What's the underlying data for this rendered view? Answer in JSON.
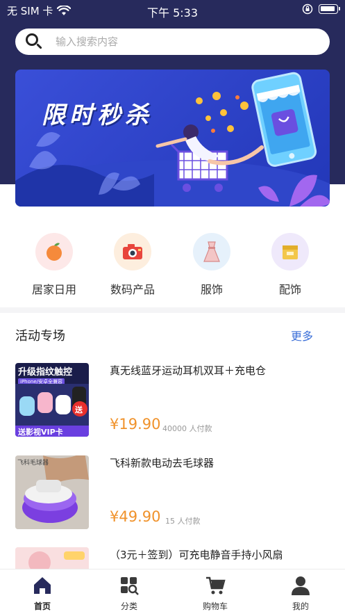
{
  "status_bar": {
    "carrier": "无 SIM 卡",
    "time": "下午 5:33"
  },
  "search": {
    "placeholder": "输入搜索内容"
  },
  "banner": {
    "title": "限时秒杀"
  },
  "categories": [
    {
      "label": "居家日用",
      "icon": "orange-icon"
    },
    {
      "label": "数码产品",
      "icon": "camera-icon"
    },
    {
      "label": "服饰",
      "icon": "dress-icon"
    },
    {
      "label": "配饰",
      "icon": "box-icon"
    }
  ],
  "section": {
    "title": "活动专场",
    "more": "更多"
  },
  "products": [
    {
      "title": "真无线蓝牙运动耳机双耳＋充电仓",
      "price": "¥19.90",
      "sold": "40000 人付款",
      "thumb_text_top": "升级指纹触控",
      "thumb_text_sub": "iPhone/安卓全兼容",
      "thumb_text_bottom": "送影视VIP卡",
      "thumb_text_badge": "送"
    },
    {
      "title": "飞科新款电动去毛球器",
      "price": "¥49.90",
      "sold": "15 人付款",
      "thumb_text_top": "飞科毛球器"
    },
    {
      "title": "（3元＋签到）可充电静音手持小风扇",
      "price": "",
      "sold": ""
    }
  ],
  "tabs": [
    {
      "label": "首页",
      "icon": "home-icon",
      "active": true
    },
    {
      "label": "分类",
      "icon": "category-icon",
      "active": false
    },
    {
      "label": "购物车",
      "icon": "cart-icon",
      "active": false
    },
    {
      "label": "我的",
      "icon": "user-icon",
      "active": false
    }
  ],
  "colors": {
    "header": "#272a5c",
    "price": "#f0922b",
    "more_link": "#3b6fd8",
    "banner": "#2a40c4"
  }
}
